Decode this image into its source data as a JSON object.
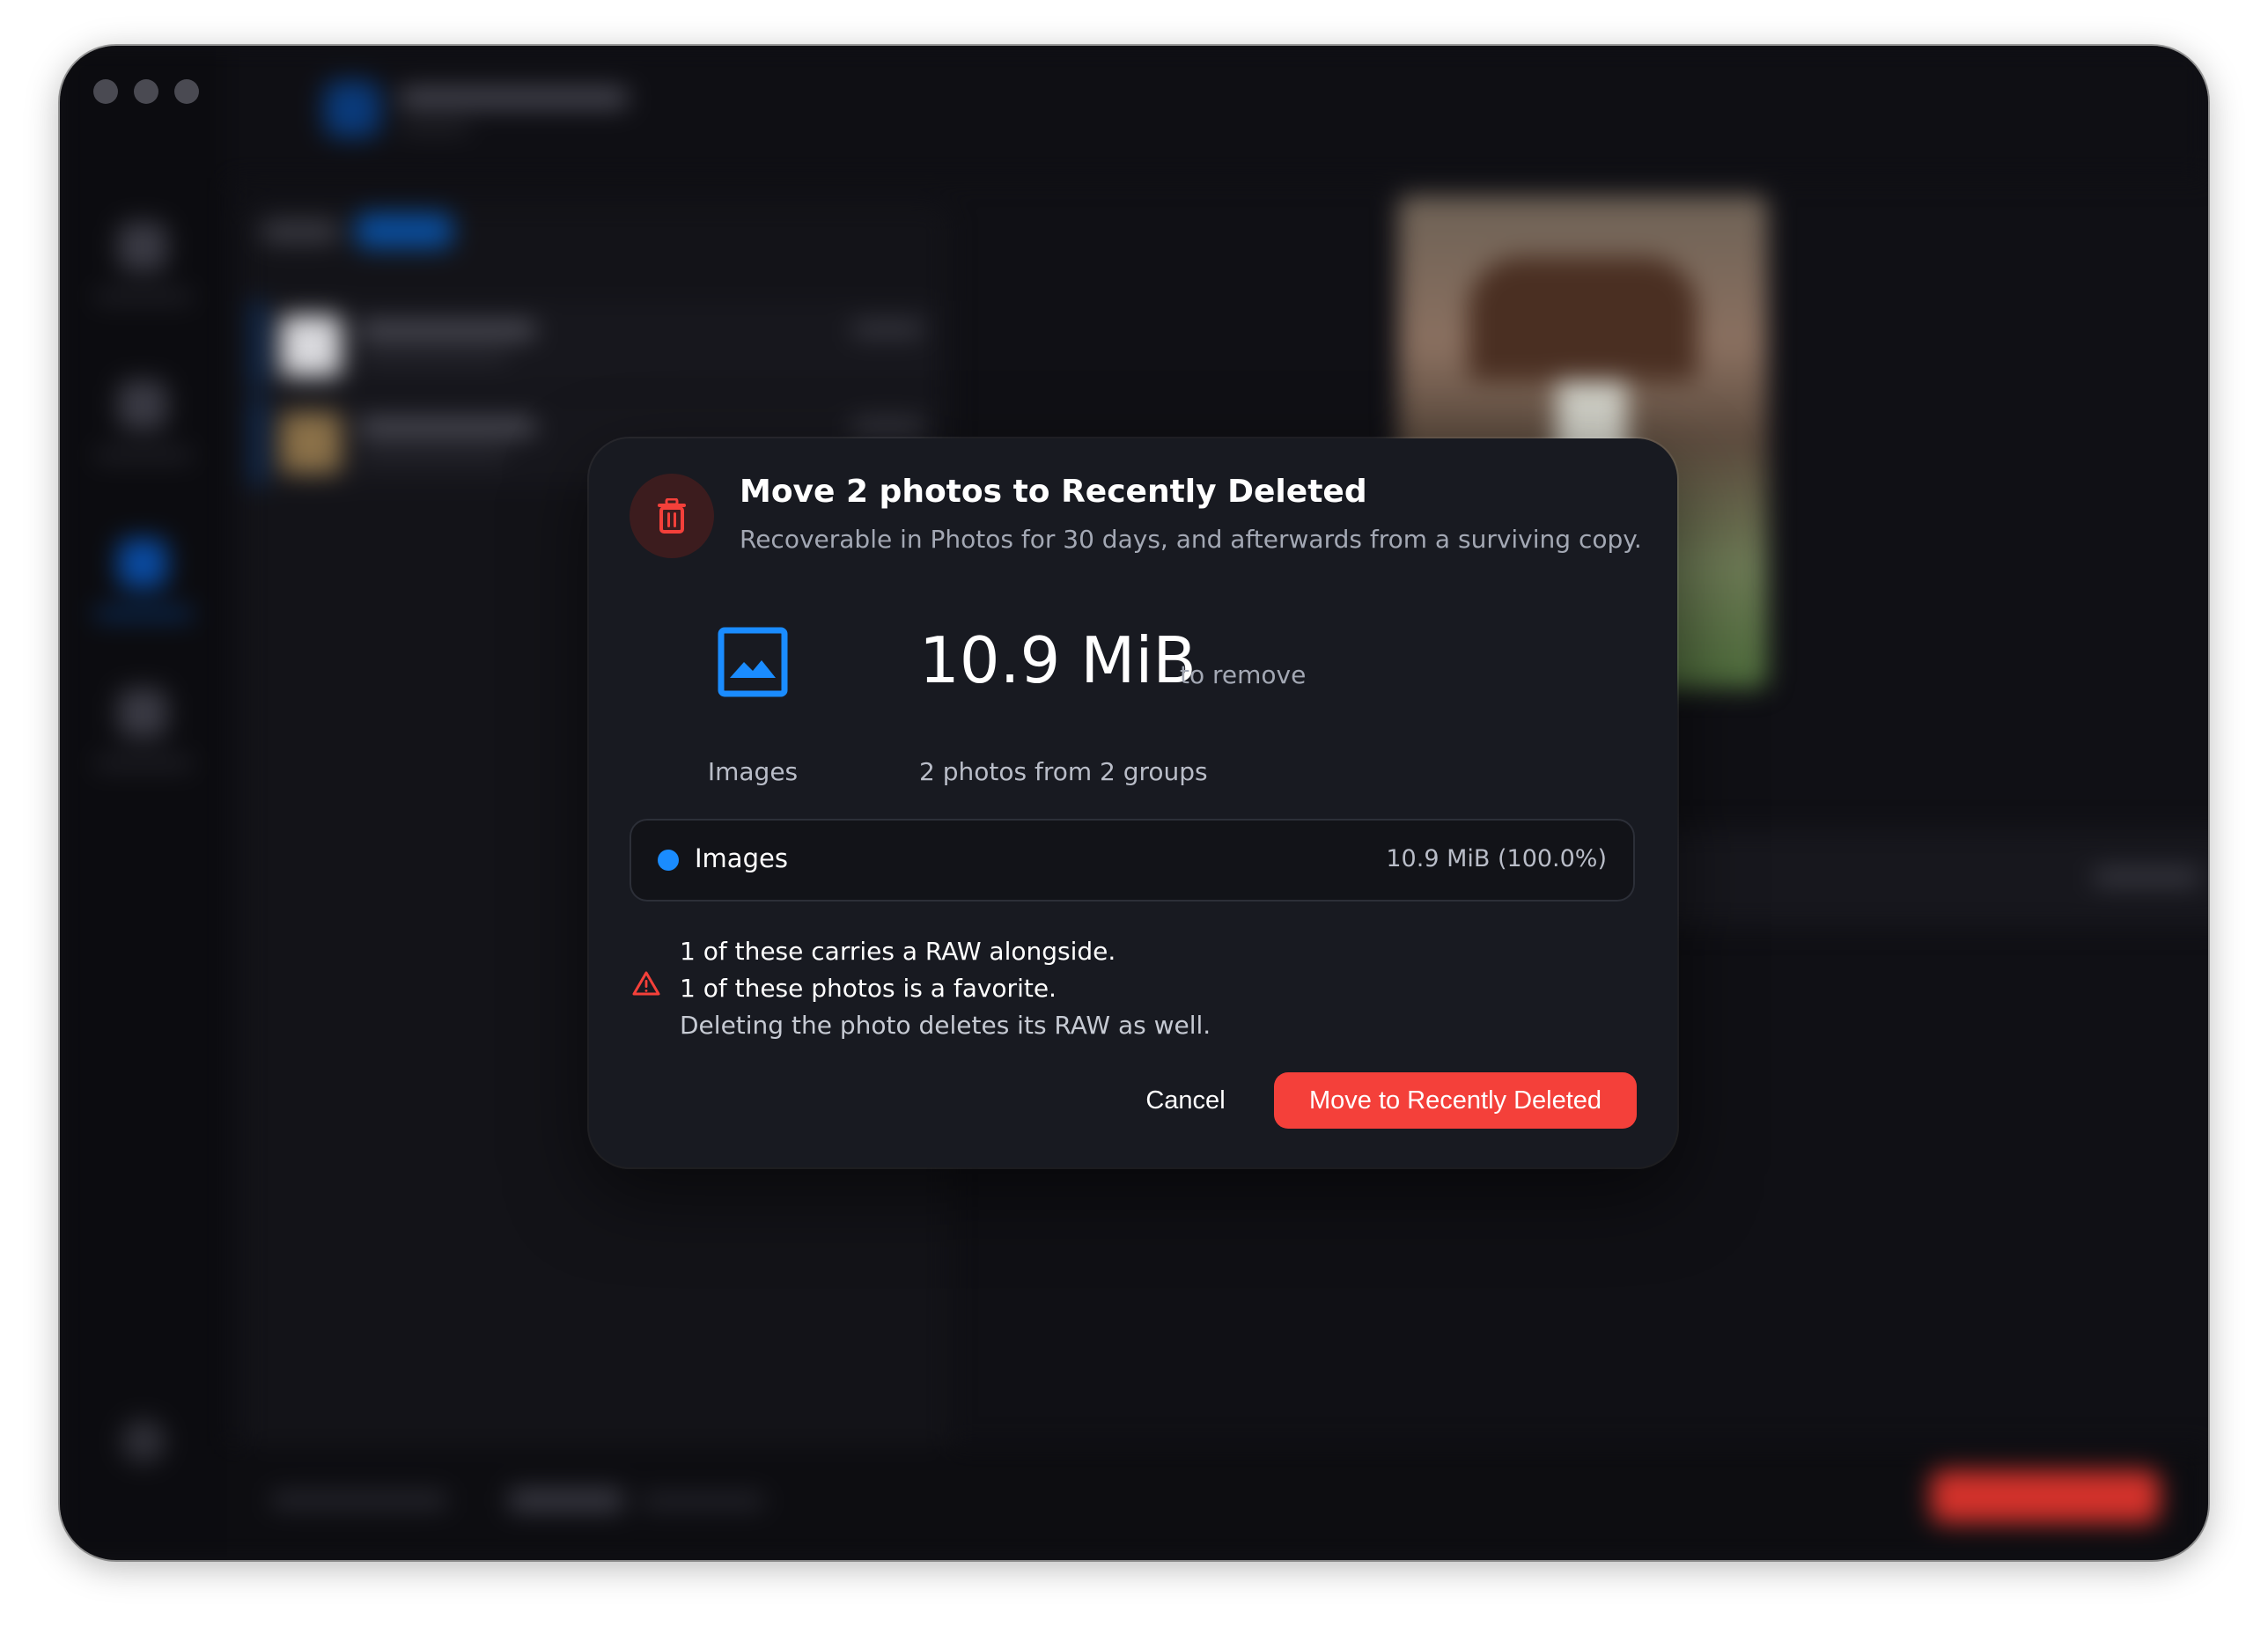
{
  "dialog": {
    "title": "Move 2 photos to Recently Deleted",
    "subtitle": "Recoverable in Photos for 30 days, and afterwards from a surviving copy.",
    "category_label": "Images",
    "size_value": "10.9 MiB",
    "size_suffix": "to remove",
    "size_description": "2 photos from 2 groups",
    "breakdown": {
      "label": "Images",
      "value": "10.9 MiB (100.0%)",
      "dot_color": "#1a8cff"
    },
    "warnings": [
      "1 of these carries a RAW alongside.",
      "1 of these photos is a favorite.",
      "Deleting the photo deletes its RAW as well."
    ],
    "cancel_label": "Cancel",
    "confirm_label": "Move to Recently Deleted",
    "icons": {
      "header": "trash-icon",
      "category": "image-icon",
      "warning": "warning-triangle-icon"
    },
    "colors": {
      "accent": "#1a8cff",
      "destructive": "#f4403a",
      "icon_bg": "#3c1c1e"
    }
  }
}
